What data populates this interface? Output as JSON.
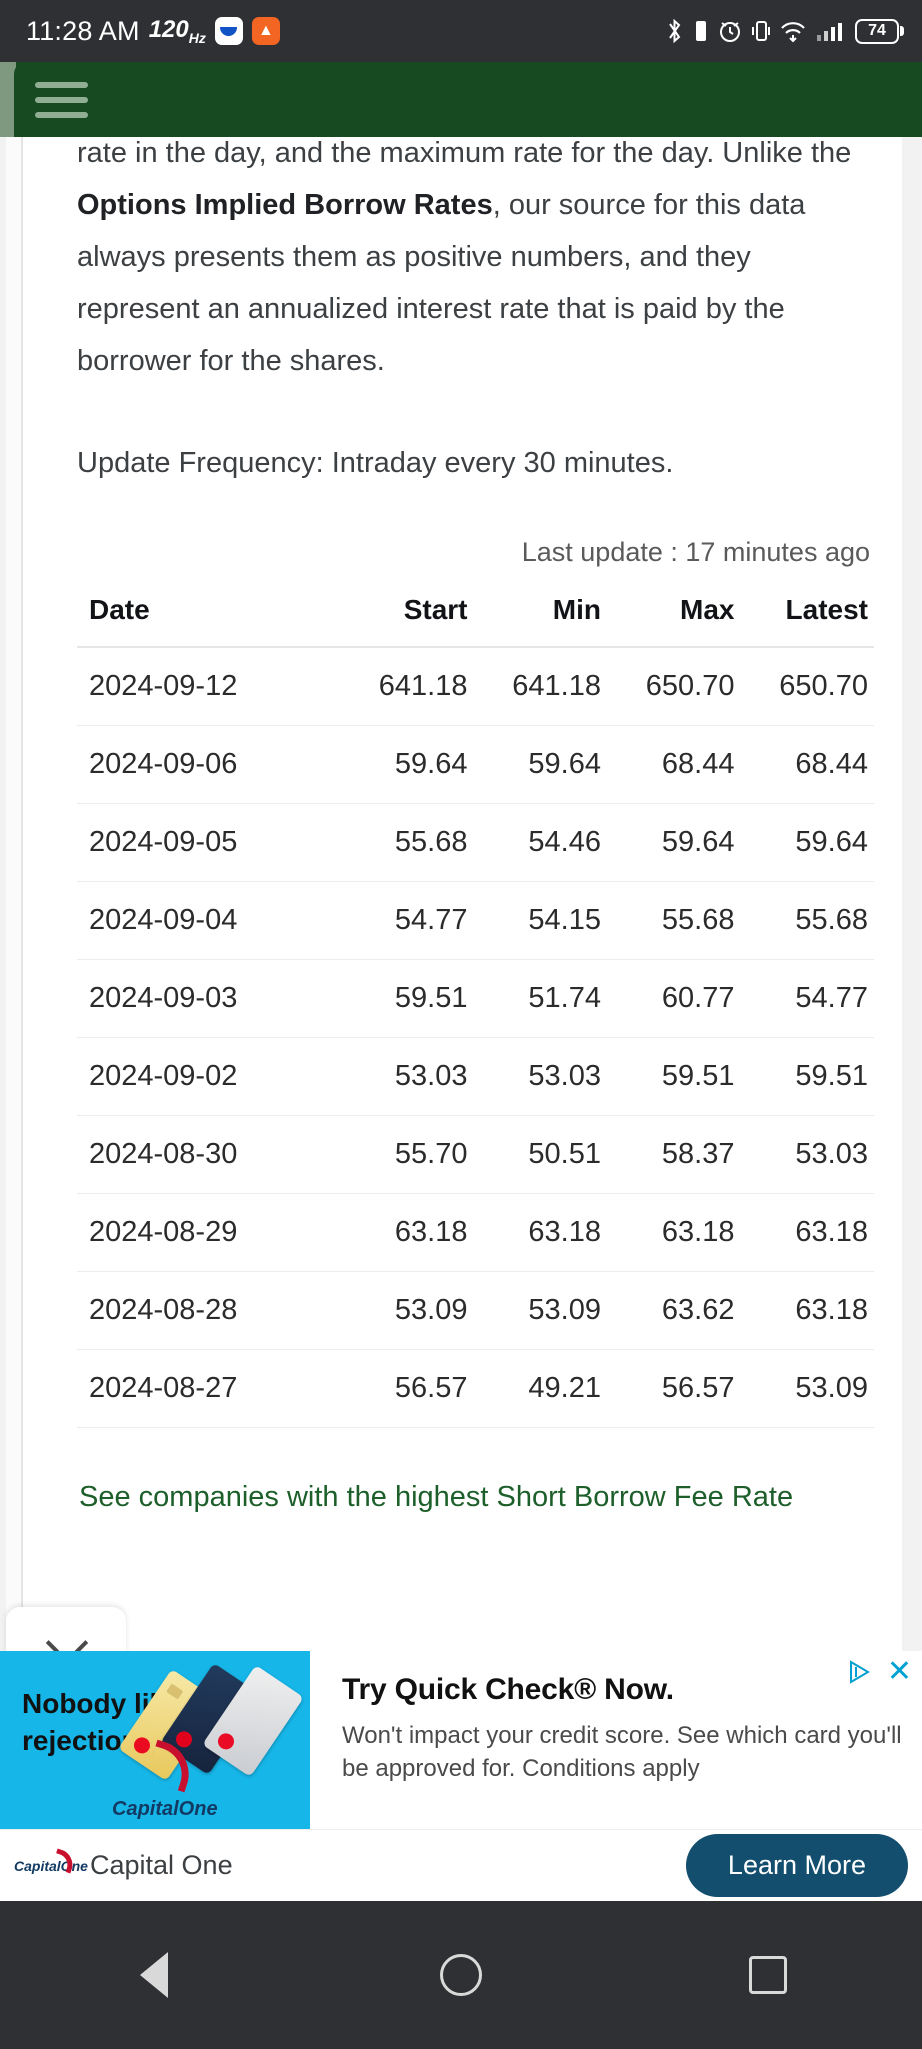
{
  "status_bar": {
    "time": "11:28 AM",
    "refresh_rate": "120",
    "refresh_rate_unit": "Hz",
    "app_icons": [
      "mail-app-icon",
      "orange-app-icon"
    ],
    "system_icons": [
      "bluetooth-icon",
      "alarm-icon",
      "vibrate-icon",
      "wifi-icon",
      "signal-icon"
    ],
    "battery_level": "74"
  },
  "app_header": {
    "menu_label": "hamburger-menu"
  },
  "content": {
    "paragraph_1_start": "rate in the day, and the maximum rate for the day. Unlike the ",
    "paragraph_1_bold": "Options Implied Borrow Rates",
    "paragraph_1_end": ", our source for this data always presents them as positive numbers, and they represent an annualized interest rate that is paid by the borrower for the shares.",
    "paragraph_2": "Update Frequency: Intraday every 30 minutes.",
    "last_update": "Last update : 17 minutes ago",
    "see_more_link": "See companies with the highest Short Borrow Fee Rate"
  },
  "table": {
    "columns": [
      "Date",
      "Start",
      "Min",
      "Max",
      "Latest"
    ],
    "rows": [
      {
        "date": "2024-09-12",
        "start": "641.18",
        "min": "641.18",
        "max": "650.70",
        "latest": "650.70"
      },
      {
        "date": "2024-09-06",
        "start": "59.64",
        "min": "59.64",
        "max": "68.44",
        "latest": "68.44"
      },
      {
        "date": "2024-09-05",
        "start": "55.68",
        "min": "54.46",
        "max": "59.64",
        "latest": "59.64"
      },
      {
        "date": "2024-09-04",
        "start": "54.77",
        "min": "54.15",
        "max": "55.68",
        "latest": "55.68"
      },
      {
        "date": "2024-09-03",
        "start": "59.51",
        "min": "51.74",
        "max": "60.77",
        "latest": "54.77"
      },
      {
        "date": "2024-09-02",
        "start": "53.03",
        "min": "53.03",
        "max": "59.51",
        "latest": "59.51"
      },
      {
        "date": "2024-08-30",
        "start": "55.70",
        "min": "50.51",
        "max": "58.37",
        "latest": "53.03"
      },
      {
        "date": "2024-08-29",
        "start": "63.18",
        "min": "63.18",
        "max": "63.18",
        "latest": "63.18"
      },
      {
        "date": "2024-08-28",
        "start": "53.09",
        "min": "53.09",
        "max": "63.62",
        "latest": "63.18"
      },
      {
        "date": "2024-08-27",
        "start": "56.57",
        "min": "49.21",
        "max": "56.57",
        "latest": "53.09"
      }
    ]
  },
  "ad": {
    "creative_headline": "Nobody likes rejection.",
    "brand_logo_text": "CapitalOne",
    "title": "Try Quick Check® Now.",
    "description": "Won't impact your credit score. See which card you'll be approved for. Conditions apply",
    "close_label": "✕",
    "brand_name": "Capital One",
    "cta_label": "Learn More"
  },
  "nav_bar": {
    "buttons": [
      "back-button",
      "home-button",
      "recents-button"
    ]
  },
  "colors": {
    "header_green": "#174a21",
    "link_green": "#1d5f2a",
    "status_bar": "#2f3033",
    "ad_cyan": "#16b6e8",
    "cta_blue": "#134e6f"
  }
}
